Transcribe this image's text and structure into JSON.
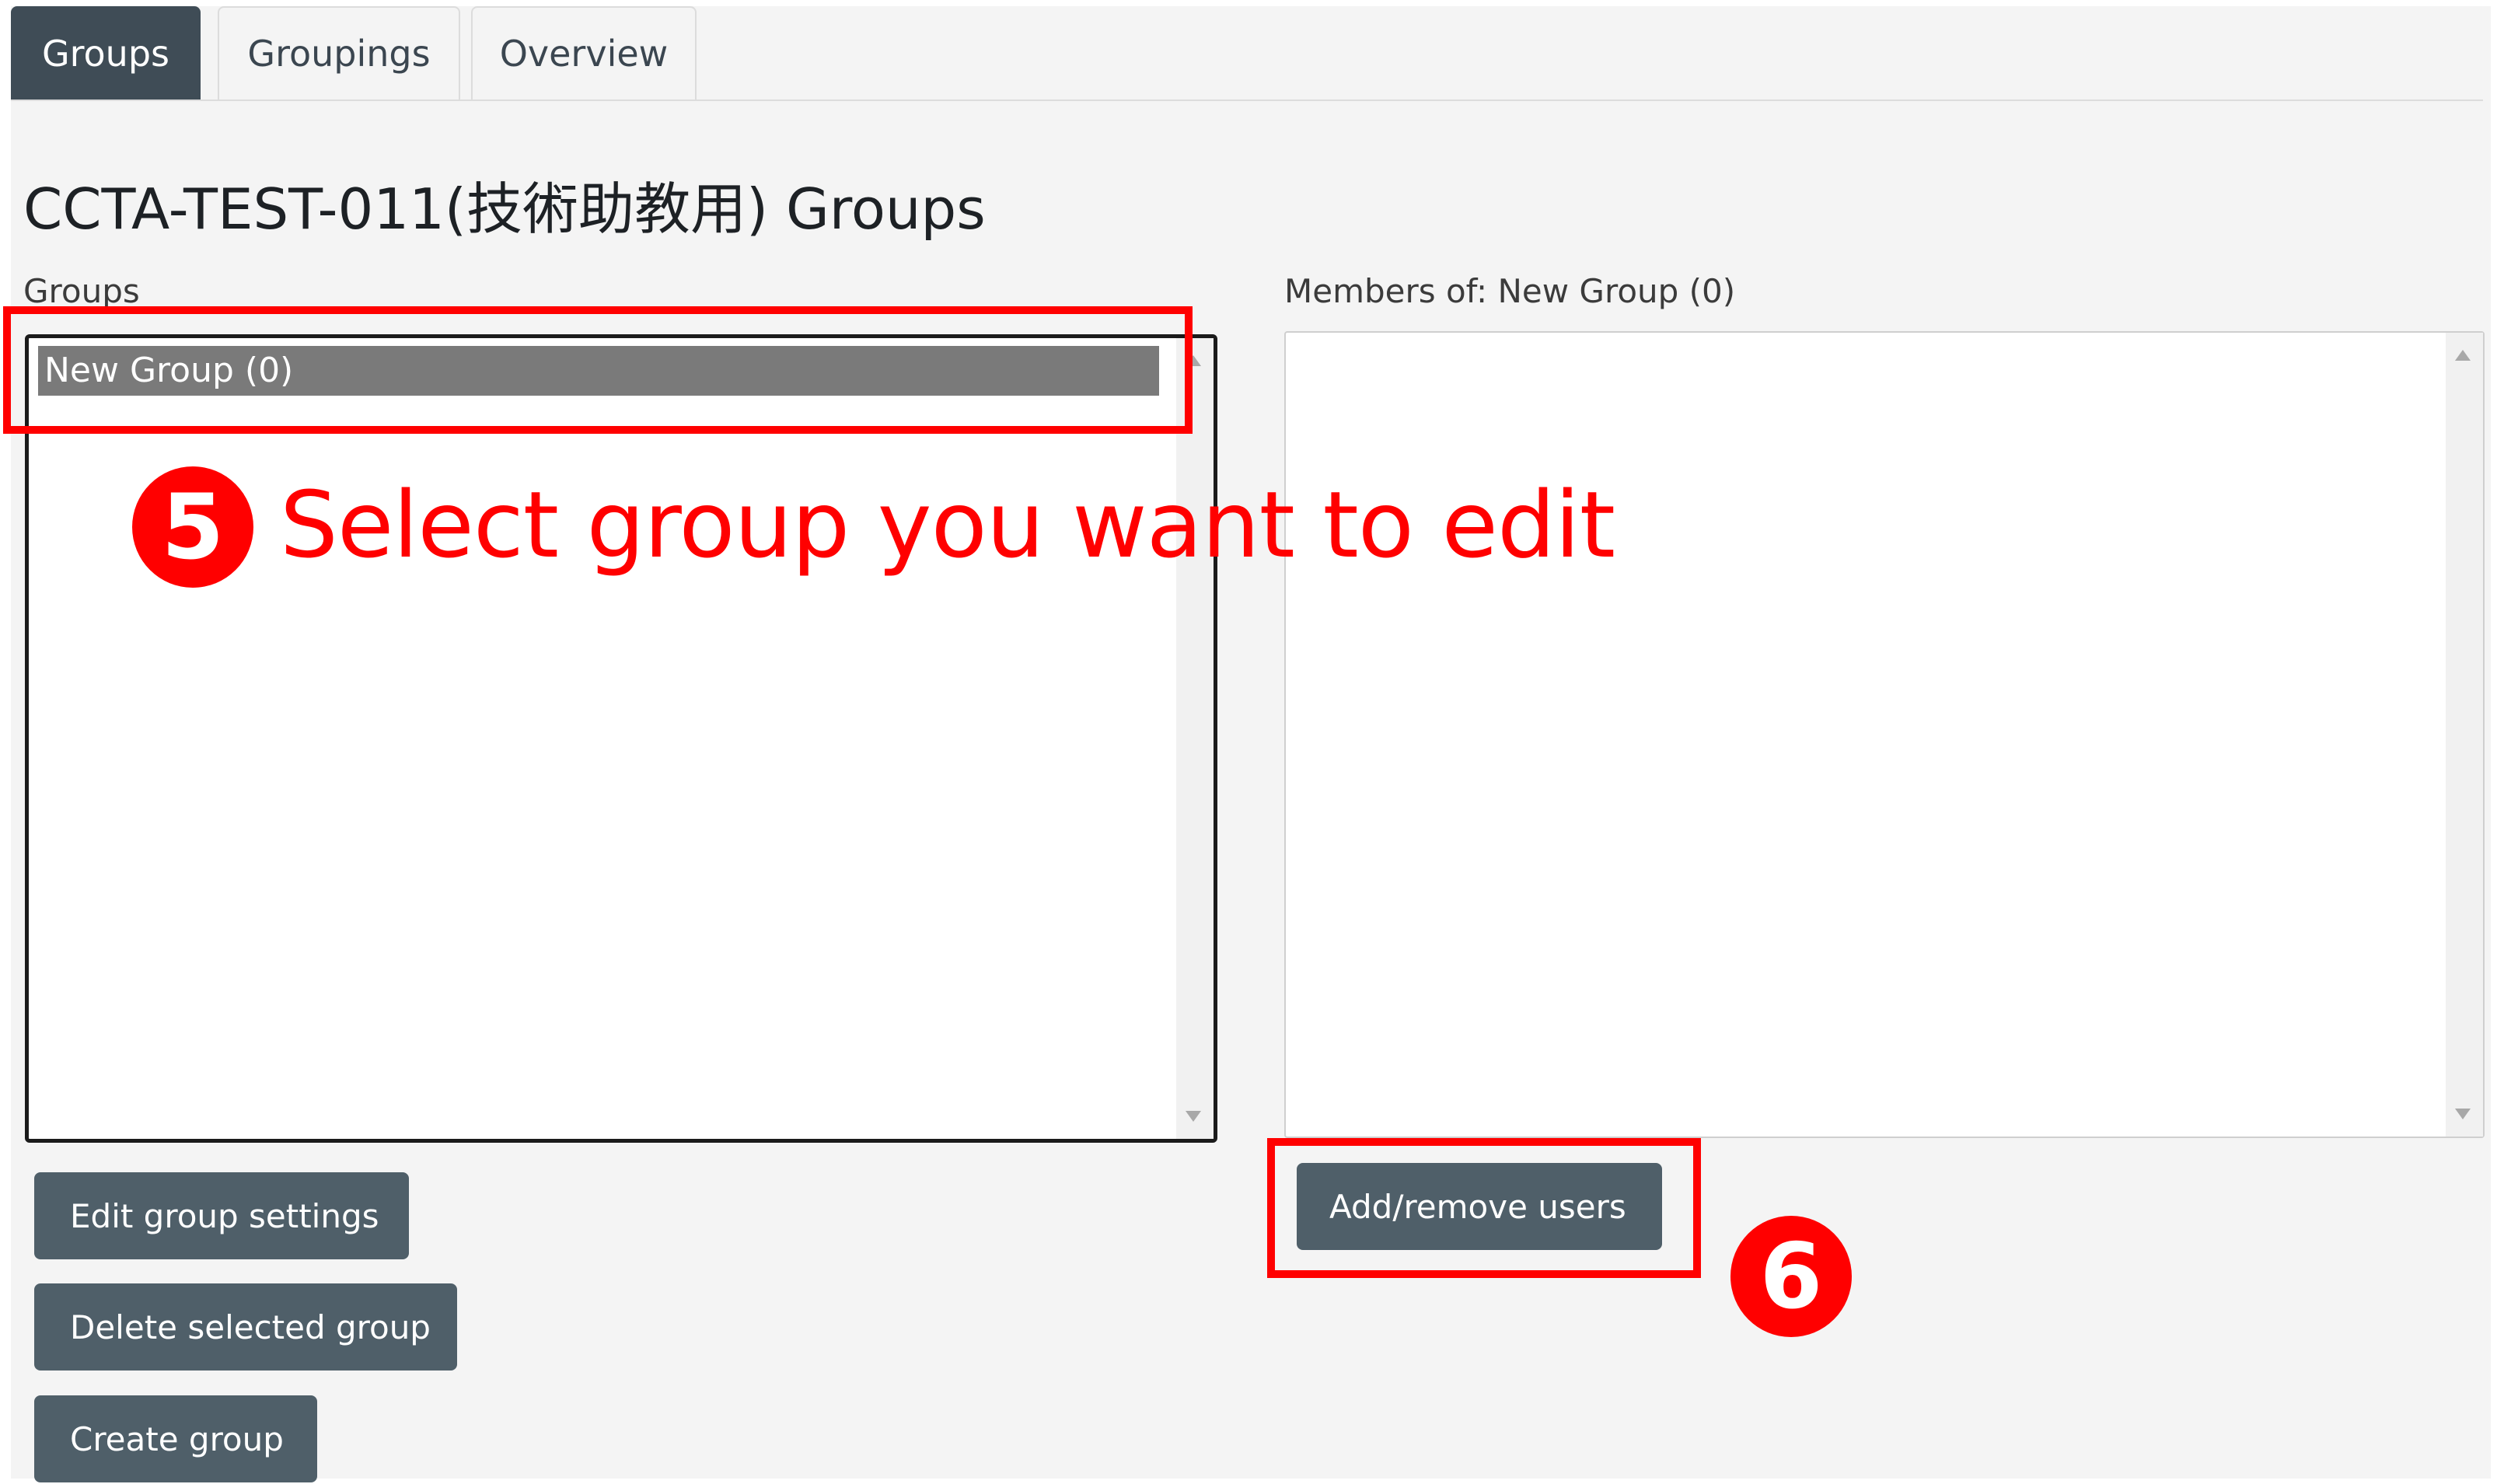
{
  "tabs": [
    {
      "label": "Groups",
      "active": true
    },
    {
      "label": "Groupings",
      "active": false
    },
    {
      "label": "Overview",
      "active": false
    }
  ],
  "page_title": "CCTA-TEST-011(技術助教用) Groups",
  "groups_panel": {
    "label": "Groups",
    "selected_option": "New Group (0)"
  },
  "members_panel": {
    "label": "Members of: New Group (0)"
  },
  "buttons": {
    "edit_group_settings": "Edit group settings",
    "delete_selected_group": "Delete selected group",
    "create_group": "Create group",
    "add_remove_users": "Add/remove users"
  },
  "annotations": {
    "step5_number": "5",
    "step5_text": "Select group you want to edit",
    "step6_number": "6"
  },
  "colors": {
    "tab_active_bg": "#3f4c56",
    "button_bg": "#4f5f69",
    "selected_option_bg": "#7a7a7a",
    "annotation_red": "#ff0000",
    "page_bg": "#f4f4f4"
  }
}
